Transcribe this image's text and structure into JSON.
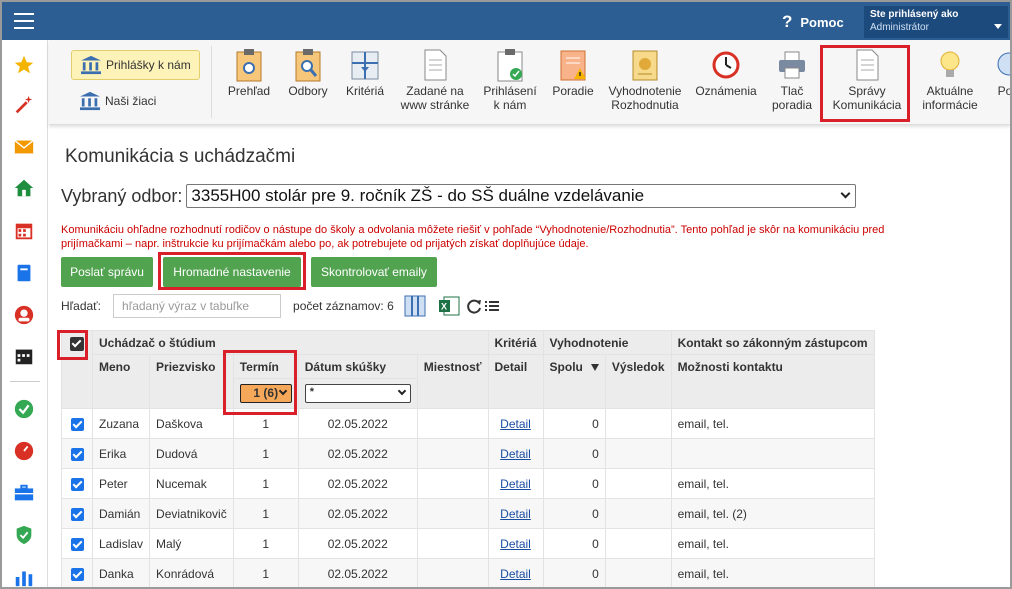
{
  "header": {
    "help_label": "Pomoc",
    "user_line1": "Ste prihlásený ako",
    "user_line2": "Administrátor"
  },
  "toolbar": {
    "left_items": [
      {
        "label": "Prihlášky k nám",
        "active": true
      },
      {
        "label": "Naši žiaci",
        "active": false
      }
    ],
    "buttons": [
      {
        "l1": "Prehľad",
        "l2": ""
      },
      {
        "l1": "Odbory",
        "l2": ""
      },
      {
        "l1": "Kritériá",
        "l2": ""
      },
      {
        "l1": "Zadané na",
        "l2": "www stránke"
      },
      {
        "l1": "Prihlásení",
        "l2": "k nám"
      },
      {
        "l1": "Poradie",
        "l2": ""
      },
      {
        "l1": "Vyhodnotenie",
        "l2": "Rozhodnutia"
      },
      {
        "l1": "Oznámenia",
        "l2": ""
      },
      {
        "l1": "Tlač",
        "l2": "poradia"
      },
      {
        "l1": "Správy",
        "l2": "Komunikácia"
      },
      {
        "l1": "Aktuálne",
        "l2": "informácie"
      },
      {
        "l1": "Po",
        "l2": ""
      }
    ]
  },
  "main": {
    "title": "Komunikácia s uchádzačmi",
    "field_label": "Vybraný odbor:",
    "field_value": "3355H00 stolár pre 9. ročník ZŠ - do SŠ duálne vzdelávanie",
    "notice_line1": "Komunikáciu ohľadne rozhodnutí rodičov o nástupe do školy a odvolania môžete riešiť v pohľade “Vyhodnotenie/Rozhodnutia”. Tento pohľad je skôr na komunikáciu pred",
    "notice_line2": "prijímačkami – napr. inštrukcie ku prijímačkám alebo po, ak potrebujete od prijatých získať doplňujúce údaje.",
    "btn_send": "Poslať správu",
    "btn_bulk": "Hromadné nastavenie",
    "btn_check": "Skontrolovať emaily",
    "search_label": "Hľadať:",
    "search_placeholder": "hľadaný výraz v tabuľke",
    "count_label": "počet záznamov: 6"
  },
  "table": {
    "groups": {
      "applicant": "Uchádzač o štúdium",
      "criteria": "Kritériá",
      "evaluation": "Vyhodnotenie",
      "contact": "Kontakt so zákonným zástupcom"
    },
    "cols": {
      "name": "Meno",
      "surname": "Priezvisko",
      "term": "Termín",
      "exam_date": "Dátum skúšky",
      "place": "Miestnosť",
      "detail": "Detail",
      "total": "Spolu",
      "result": "Výsledok",
      "contact_opts": "Možnosti kontaktu"
    },
    "filter_term": "1 (6)",
    "filter_date": "*",
    "detail_link": "Detail",
    "rows": [
      {
        "name": "Zuzana",
        "surname": "Daškova",
        "term": "1",
        "date": "02.05.2022",
        "total": "0",
        "contact": "email, tel."
      },
      {
        "name": "Erika",
        "surname": "Dudová",
        "term": "1",
        "date": "02.05.2022",
        "total": "0",
        "contact": ""
      },
      {
        "name": "Peter",
        "surname": "Nucemak",
        "term": "1",
        "date": "02.05.2022",
        "total": "0",
        "contact": "email, tel."
      },
      {
        "name": "Damián",
        "surname": "Deviatnikovič",
        "term": "1",
        "date": "02.05.2022",
        "total": "0",
        "contact": "email, tel. (2)"
      },
      {
        "name": "Ladislav",
        "surname": "Malý",
        "term": "1",
        "date": "02.05.2022",
        "total": "0",
        "contact": "email, tel."
      },
      {
        "name": "Danka",
        "surname": "Konrádová",
        "term": "1",
        "date": "02.05.2022",
        "total": "0",
        "contact": "email, tel."
      }
    ]
  },
  "icons": {
    "sidebar": [
      "star-icon",
      "magic-wand-icon",
      "mail-icon",
      "home-icon",
      "calendar-icon",
      "notebook-icon",
      "user-icon",
      "schedule-icon",
      "check-circle-icon",
      "gauge-icon",
      "briefcase-icon",
      "shield-check-icon",
      "bar-chart-icon"
    ]
  },
  "colors": {
    "header_bg": "#2c5d93",
    "green_button": "#52a350",
    "highlight_red": "#d9202a",
    "notice_red": "#cc0000"
  }
}
